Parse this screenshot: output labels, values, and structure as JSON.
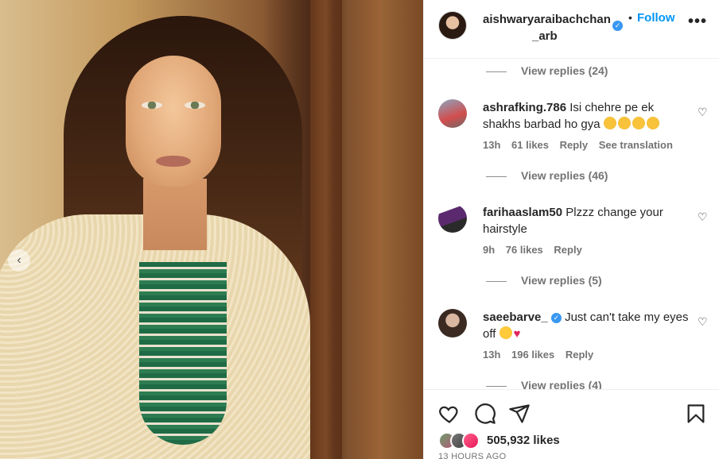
{
  "post": {
    "username_line1": "aishwaryaraibachchan",
    "username_line2": "_arb",
    "follow_label": "Follow",
    "dot": "•",
    "more": "•••"
  },
  "comments": {
    "replies_1": "View replies (24)",
    "items": [
      {
        "username": "ashrafking.786",
        "text": "Isi chehre pe ek shakhs barbad ho gya",
        "time": "13h",
        "likes": "61 likes",
        "reply": "Reply",
        "translate": "See translation",
        "view_replies": "View replies (46)"
      },
      {
        "username": "farihaaslam50",
        "text": "Plzzz change your hairstyle",
        "time": "9h",
        "likes": "76 likes",
        "reply": "Reply",
        "view_replies": "View replies (5)"
      },
      {
        "username": "saeebarve_",
        "text": "Just can't take my eyes off",
        "time": "13h",
        "likes": "196 likes",
        "reply": "Reply",
        "view_replies": "View replies (4)"
      }
    ]
  },
  "footer": {
    "likes": "505,932 likes",
    "time_ago": "13 HOURS AGO"
  },
  "colors": {
    "follow": "#0095f6",
    "verified": "#3897f0",
    "muted": "#737373"
  },
  "icons": [
    "heart-icon",
    "comment-icon",
    "share-icon",
    "bookmark-icon",
    "verified-icon",
    "more-icon",
    "chevron-left-icon"
  ]
}
